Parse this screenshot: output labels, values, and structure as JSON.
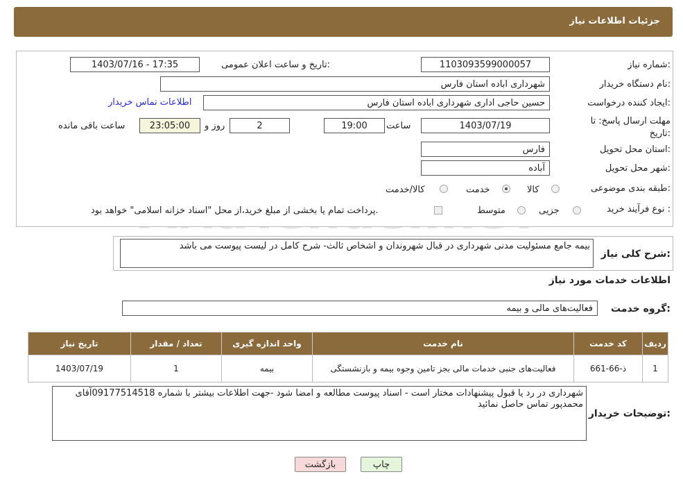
{
  "header": {
    "title": "جزئیات اطلاعات نیاز"
  },
  "form": {
    "need_number_label": "شماره نیاز:",
    "need_number": "1103093599000057",
    "announce_label": "تاریخ و ساعت اعلان عمومی:",
    "announce_value": "1403/07/16 - 17:35",
    "buyer_org_label": "نام دستگاه خریدار:",
    "buyer_org": "شهرداری اباده استان فارس",
    "creator_label": "ایجاد کننده درخواست:",
    "creator": "حسین حاجی اداری شهرداری اباده استان فارس",
    "contact_link": "اطلاعات تماس خریدار",
    "deadline_label": "مهلت ارسال پاسخ: تا تاریخ:",
    "deadline_date": "1403/07/19",
    "time_label": "ساعت",
    "deadline_time": "19:00",
    "days": "2",
    "days_label": "روز و",
    "remaining": "23:05:00",
    "remaining_label": "ساعت باقی مانده",
    "province_label": "استان محل تحویل:",
    "province": "فارس",
    "city_label": "شهر محل تحویل:",
    "city": "آباده",
    "category_label": "طبقه بندی موضوعی:",
    "category_options": [
      "کالا",
      "خدمت",
      "کالا/خدمت"
    ],
    "category_selected": "خدمت",
    "process_label": "نوع فرآیند خرید :",
    "process_options": [
      "جزیی",
      "متوسط"
    ],
    "process_note": "پرداخت تمام یا بخشی از مبلغ خرید،از محل \"اسناد خزانه اسلامی\" خواهد بود."
  },
  "description": {
    "label": "شرح کلی نیاز:",
    "text": "بیمه جامع مسئولیت مدنی شهرداری در قبال شهروندان و اشخاص ثالث- شرح کامل در لیست پیوست می باشد"
  },
  "services": {
    "section_title": "اطلاعات خدمات مورد نیاز",
    "group_label": "گروه خدمت:",
    "group_value": "فعالیت‌های مالی و بیمه",
    "columns": [
      "ردیف",
      "کد خدمت",
      "نام خدمت",
      "واحد اندازه گیری",
      "تعداد / مقدار",
      "تاریخ نیاز"
    ],
    "rows": [
      [
        "1",
        "ذ-66-661",
        "فعالیت‌های جنبی خدمات مالی بجز تامین وجوه بیمه و بازنشستگی",
        "بیمه",
        "1",
        "1403/07/19"
      ]
    ]
  },
  "buyer_notes": {
    "label": "توضیحات خریدار:",
    "text": "شهرداری در رد یا قبول پیشنهادات مختار است - اسناد پیوست مطالعه و امضا شود -جهت اطلاعات بیشتر با شماره 09177514518آقای محمدپور تماس حاصل نمائید"
  },
  "buttons": {
    "print": "چاپ",
    "back": "بازگشت"
  },
  "watermark": "AriaTender.neT",
  "colors": {
    "header": "#8b6a3c",
    "link": "#2a2ad0",
    "back_button": "#f7d9d9",
    "print_button": "#e5f5dc"
  }
}
